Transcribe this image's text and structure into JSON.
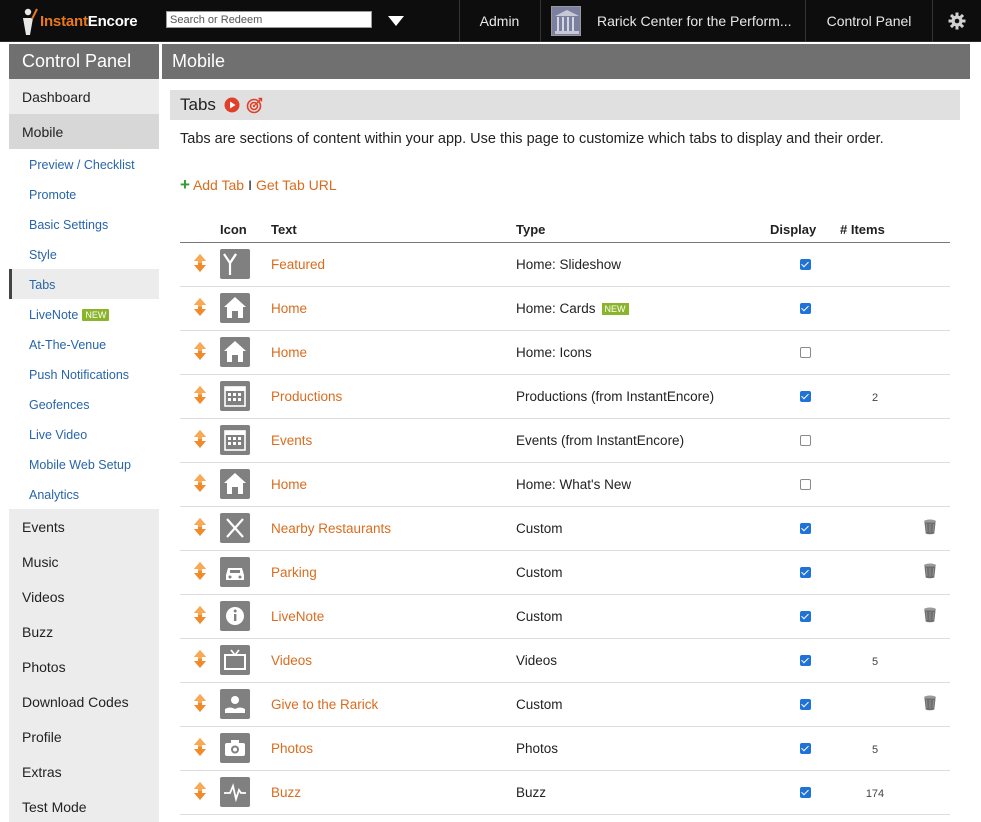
{
  "topbar": {
    "logo_text_instant": "Instant",
    "logo_text_encore": "Encore",
    "search_placeholder": "Search or Redeem",
    "admin_label": "Admin",
    "venue_label": "Rarick Center for the Perform...",
    "control_panel_label": "Control Panel"
  },
  "sidebar": {
    "title": "Control Panel",
    "items_top": [
      {
        "label": "Dashboard",
        "active": false
      },
      {
        "label": "Mobile",
        "active": true
      }
    ],
    "sub_items": [
      {
        "label": "Preview / Checklist"
      },
      {
        "label": "Promote"
      },
      {
        "label": "Basic Settings"
      },
      {
        "label": "Style"
      },
      {
        "label": "Tabs",
        "active": true
      },
      {
        "label": "LiveNote",
        "badge": "NEW"
      },
      {
        "label": "At-The-Venue"
      },
      {
        "label": "Push Notifications"
      },
      {
        "label": "Geofences"
      },
      {
        "label": "Live Video"
      },
      {
        "label": "Mobile Web Setup"
      },
      {
        "label": "Analytics"
      }
    ],
    "items_bottom": [
      {
        "label": "Events"
      },
      {
        "label": "Music"
      },
      {
        "label": "Videos"
      },
      {
        "label": "Buzz"
      },
      {
        "label": "Photos"
      },
      {
        "label": "Download Codes"
      },
      {
        "label": "Profile"
      },
      {
        "label": "Extras"
      },
      {
        "label": "Test Mode"
      }
    ]
  },
  "main": {
    "title": "Mobile",
    "panel_title": "Tabs",
    "description": "Tabs are sections of content within your app. Use this page to customize which tabs to display and their order.",
    "add_tab_label": "Add Tab",
    "separator": "I",
    "get_tab_url_label": "Get Tab URL",
    "columns": {
      "icon": "Icon",
      "text": "Text",
      "type": "Type",
      "display": "Display",
      "items": "# Items"
    },
    "rows": [
      {
        "icon": "slideshow-icon",
        "text": "Featured",
        "type": "Home: Slideshow",
        "display": true,
        "items": "",
        "deletable": false
      },
      {
        "icon": "home-icon",
        "text": "Home",
        "type": "Home: Cards",
        "type_badge": "NEW",
        "display": true,
        "items": "",
        "deletable": false
      },
      {
        "icon": "home-icon",
        "text": "Home",
        "type": "Home: Icons",
        "display": false,
        "items": "",
        "deletable": false
      },
      {
        "icon": "calendar-icon",
        "text": "Productions",
        "type": "Productions (from InstantEncore)",
        "display": true,
        "items": "2",
        "deletable": false
      },
      {
        "icon": "calendar-icon",
        "text": "Events",
        "type": "Events (from InstantEncore)",
        "display": false,
        "items": "",
        "deletable": false
      },
      {
        "icon": "home-icon",
        "text": "Home",
        "type": "Home: What's New",
        "display": false,
        "items": "",
        "deletable": false
      },
      {
        "icon": "fork-knife-icon",
        "text": "Nearby Restaurants",
        "type": "Custom",
        "display": true,
        "items": "",
        "deletable": true
      },
      {
        "icon": "car-icon",
        "text": "Parking",
        "type": "Custom",
        "display": true,
        "items": "",
        "deletable": true
      },
      {
        "icon": "info-icon",
        "text": "LiveNote",
        "type": "Custom",
        "display": true,
        "items": "",
        "deletable": true
      },
      {
        "icon": "tv-icon",
        "text": "Videos",
        "type": "Videos",
        "display": true,
        "items": "5",
        "deletable": false
      },
      {
        "icon": "hand-heart-icon",
        "text": "Give to the Rarick",
        "type": "Custom",
        "display": true,
        "items": "",
        "deletable": true
      },
      {
        "icon": "camera-icon",
        "text": "Photos",
        "type": "Photos",
        "display": true,
        "items": "5",
        "deletable": false
      },
      {
        "icon": "pulse-icon",
        "text": "Buzz",
        "type": "Buzz",
        "display": true,
        "items": "174",
        "deletable": false
      }
    ]
  }
}
